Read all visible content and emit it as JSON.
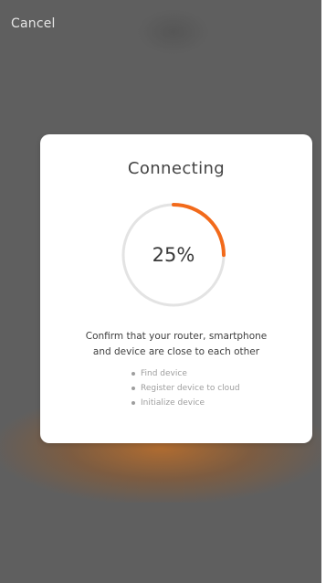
{
  "header": {
    "cancel_label": "Cancel"
  },
  "dialog": {
    "title": "Connecting",
    "progress": {
      "value": 0.25,
      "label": "25%"
    },
    "message_line1": "Confirm that your router, smartphone",
    "message_line2": "and device are close to each other",
    "steps": [
      {
        "label": "Find device"
      },
      {
        "label": "Register device to cloud"
      },
      {
        "label": "Initialize device"
      }
    ]
  },
  "colors": {
    "accent": "#f26a1b",
    "track": "#e3e3e3",
    "backdrop": "#5f5f5f"
  }
}
